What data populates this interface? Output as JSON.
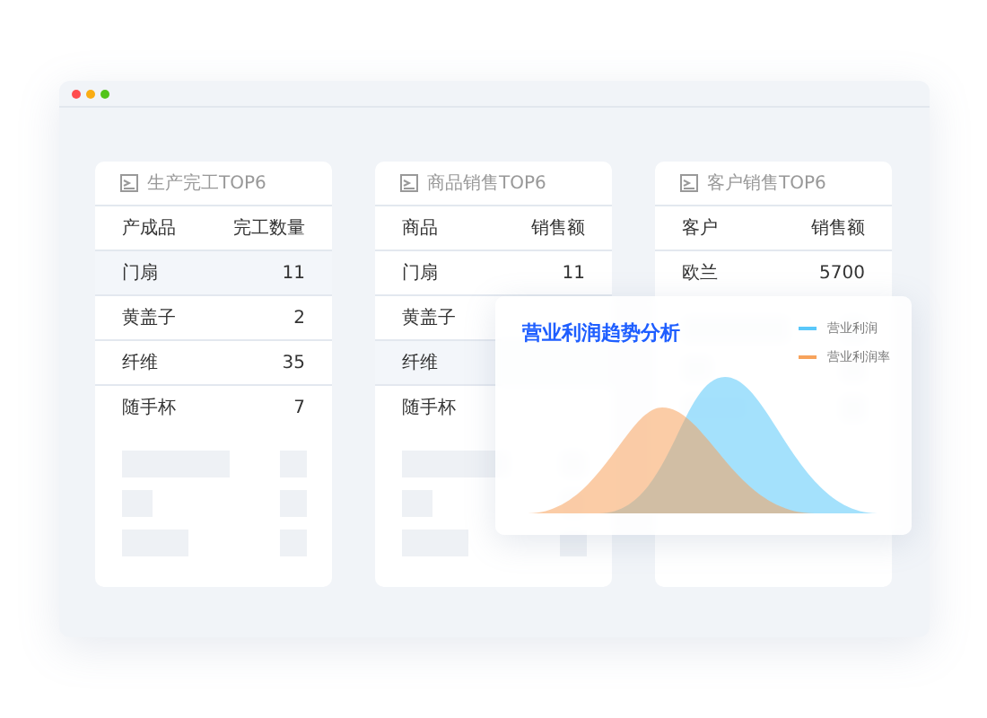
{
  "cards": [
    {
      "title": "生产完工TOP6",
      "columns": [
        "产成品",
        "完工数量"
      ],
      "rows": [
        {
          "name": "门扇",
          "value": "11",
          "selected": true
        },
        {
          "name": "黄盖子",
          "value": "2",
          "selected": false
        },
        {
          "name": "纤维",
          "value": "35",
          "selected": false
        },
        {
          "name": "随手杯",
          "value": "7",
          "selected": false
        }
      ]
    },
    {
      "title": "商品销售TOP6",
      "columns": [
        "商品",
        "销售额"
      ],
      "rows": [
        {
          "name": "门扇",
          "value": "11",
          "selected": false
        },
        {
          "name": "黄盖子",
          "selected": false
        },
        {
          "name": "纤维",
          "selected": true
        },
        {
          "name": "随手杯",
          "selected": false
        }
      ]
    },
    {
      "title": "客户销售TOP6",
      "columns": [
        "客户",
        "销售额"
      ],
      "rows": [
        {
          "name": "欧兰",
          "value": "5700",
          "selected": false
        }
      ]
    }
  ],
  "overlay": {
    "title": "营业利润趋势分析",
    "legend": [
      {
        "label": "营业利润",
        "color": "#5ac8fa"
      },
      {
        "label": "营业利润率",
        "color": "#f7a35c"
      }
    ]
  }
}
